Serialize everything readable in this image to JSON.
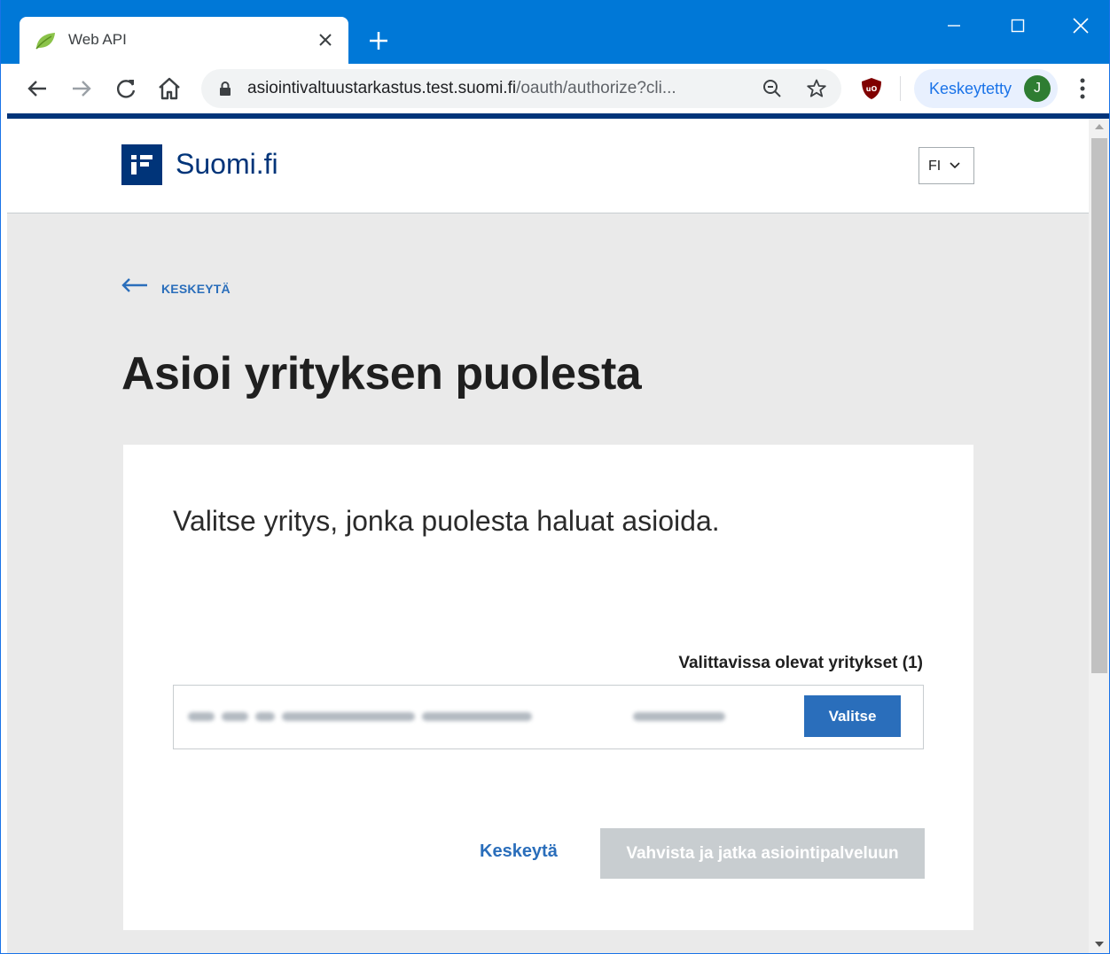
{
  "browser": {
    "tab": {
      "title": "Web API",
      "favicon": "leaf-icon"
    },
    "new_tab_icon": "plus-icon",
    "window_controls": [
      "minimize-icon",
      "maximize-icon",
      "close-icon"
    ],
    "address": {
      "host": "asiointivaltuustarkastus.test.suomi.fi",
      "path": "/oauth/authorize?cli..."
    },
    "profile": {
      "label": "Keskeytetty",
      "initial": "J",
      "color": "#2e7d32"
    },
    "accent": "#0078d7"
  },
  "site": {
    "logo_text": "Suomi.fi",
    "language": "FI",
    "brand_color": "#003479"
  },
  "page": {
    "back_label": "KESKEYTÄ",
    "title": "Asioi yrityksen puolesta",
    "lead": "Valitse yritys, jonka puolesta haluat asioida.",
    "list_label": "Valittavissa olevat yritykset (1)",
    "companies": [
      {
        "select_label": "Valitse"
      }
    ],
    "cancel_label": "Keskeytä",
    "confirm_label": "Vahvista ja jatka asiointipalveluun",
    "link_color": "#2a6ebb"
  }
}
